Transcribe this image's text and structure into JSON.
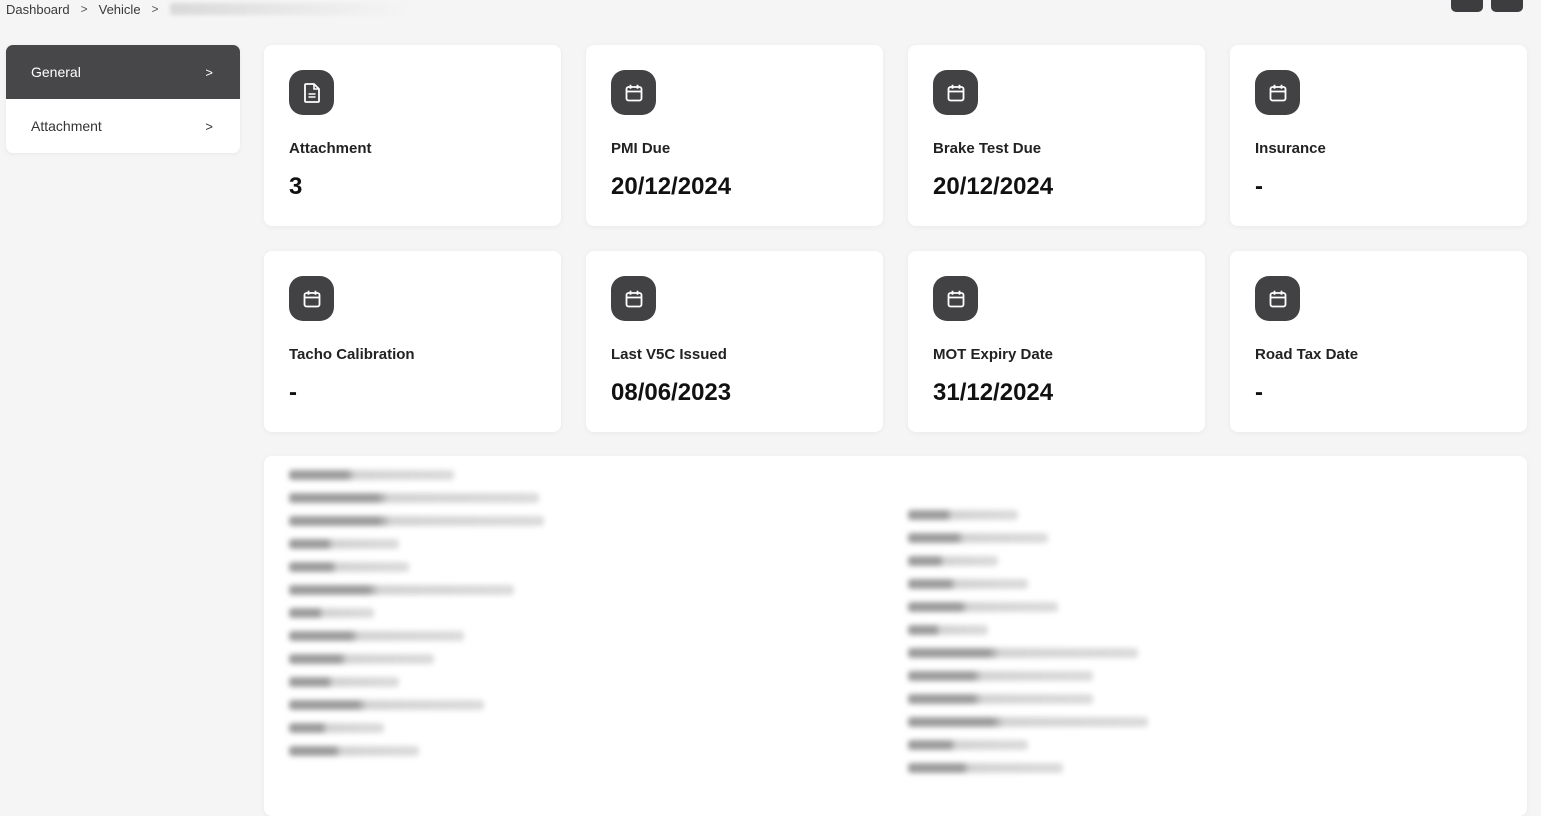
{
  "breadcrumb": {
    "items": [
      "Dashboard",
      "Vehicle"
    ],
    "separator": ">"
  },
  "sidebar": {
    "items": [
      {
        "label": "General",
        "active": true
      },
      {
        "label": "Attachment",
        "active": false
      }
    ],
    "chevron": ">"
  },
  "cards": [
    {
      "icon": "document-icon",
      "title": "Attachment",
      "value": "3"
    },
    {
      "icon": "calendar-icon",
      "title": "PMI Due",
      "value": "20/12/2024"
    },
    {
      "icon": "calendar-icon",
      "title": "Brake Test Due",
      "value": "20/12/2024"
    },
    {
      "icon": "calendar-icon",
      "title": "Insurance",
      "value": "-"
    },
    {
      "icon": "calendar-icon",
      "title": "Tacho Calibration",
      "value": "-"
    },
    {
      "icon": "calendar-icon",
      "title": "Last V5C Issued",
      "value": "08/06/2023"
    },
    {
      "icon": "calendar-icon",
      "title": "MOT Expiry Date",
      "value": "31/12/2024"
    },
    {
      "icon": "calendar-icon",
      "title": "Road Tax Date",
      "value": "-"
    }
  ],
  "colors": {
    "accent_dark": "#47474a",
    "icon_bg": "#424244",
    "page_bg": "#f5f5f6",
    "card_bg": "#ffffff"
  }
}
